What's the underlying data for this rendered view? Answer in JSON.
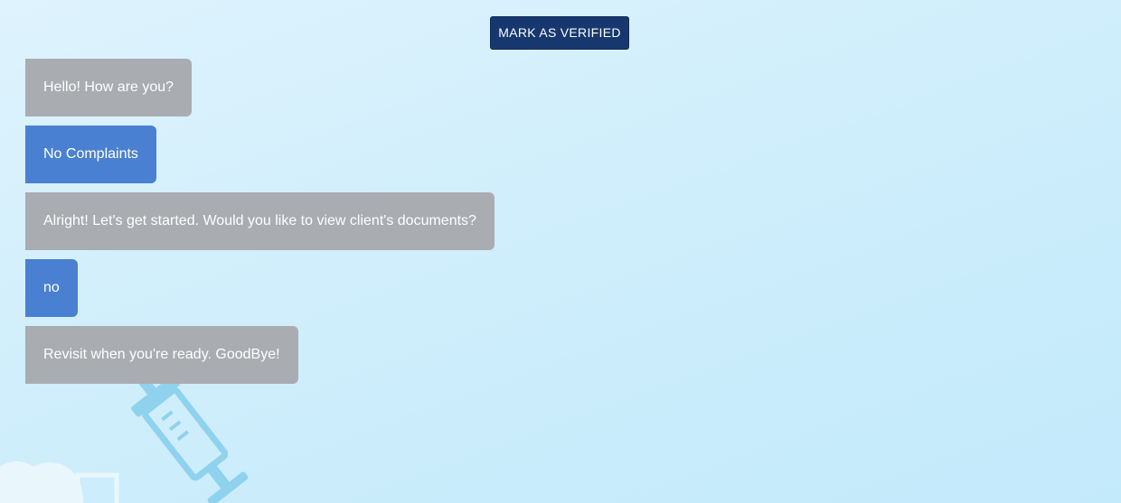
{
  "header": {
    "verify_button_label": "MARK AS VERIFIED"
  },
  "conversation": {
    "messages": [
      {
        "sender": "bot",
        "text": "Hello! How are you?"
      },
      {
        "sender": "user",
        "text": "No Complaints"
      },
      {
        "sender": "bot",
        "text": "Alright! Let's get started. Would you like to view client's documents?"
      },
      {
        "sender": "user",
        "text": "no"
      },
      {
        "sender": "bot",
        "text": "Revisit when you're ready. GoodBye!"
      }
    ]
  },
  "colors": {
    "verify_button": "#17386f",
    "bot_bubble": "#a9acb1",
    "user_bubble": "#4a80d1",
    "background": "#d3effc"
  },
  "decorations": [
    "syringe-illustration",
    "cloud-illustration"
  ]
}
